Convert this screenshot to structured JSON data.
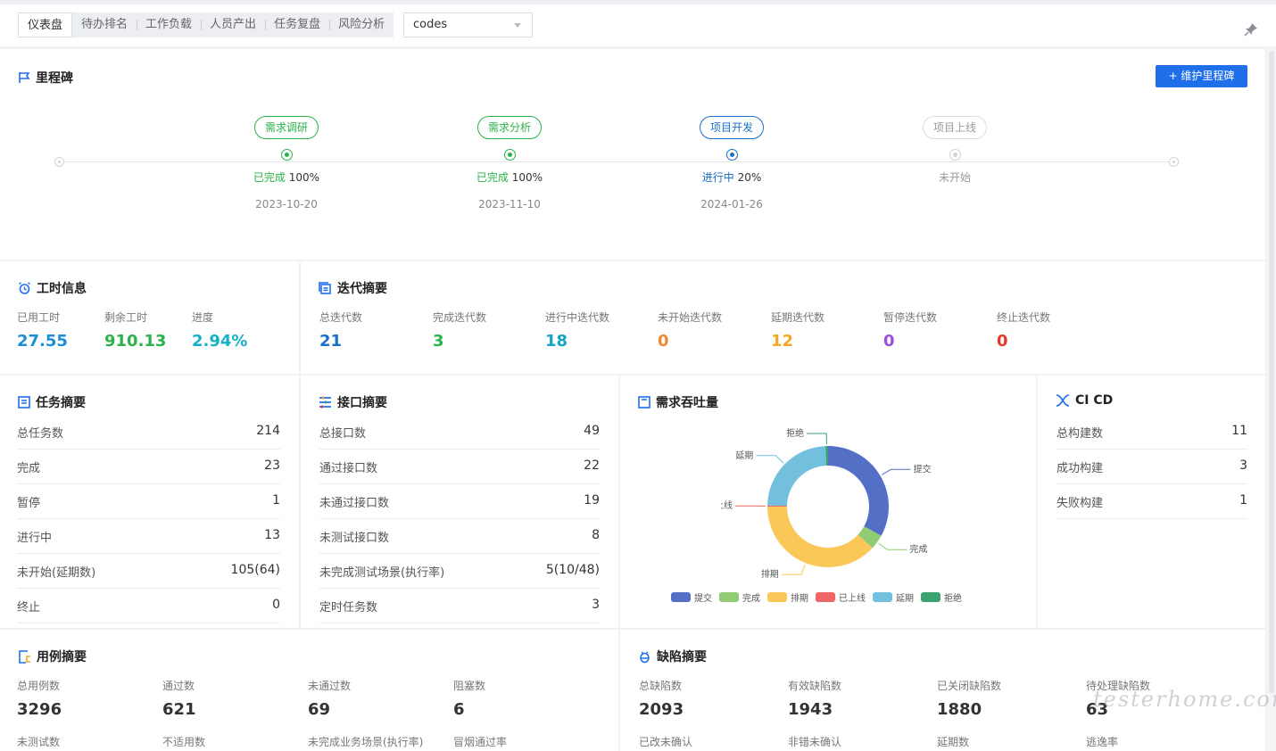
{
  "tabs": [
    "仪表盘",
    "待办排名",
    "工作负载",
    "人员产出",
    "任务复盘",
    "风险分析"
  ],
  "project_select": {
    "value": "codes"
  },
  "milestone": {
    "title": "里程碑",
    "add_button": "+ 维护里程碑",
    "items": [
      {
        "name": "需求调研",
        "status": "已完成",
        "progress": "100%",
        "date": "2023-10-20",
        "state": "done"
      },
      {
        "name": "需求分析",
        "status": "已完成",
        "progress": "100%",
        "date": "2023-11-10",
        "state": "done"
      },
      {
        "name": "项目开发",
        "status": "进行中",
        "progress": "20%",
        "date": "2024-01-26",
        "state": "active"
      },
      {
        "name": "项目上线",
        "status": "未开始",
        "progress": "",
        "date": "",
        "state": "todo"
      }
    ]
  },
  "worktime": {
    "title": "工时信息",
    "stats": [
      {
        "label": "已用工时",
        "value": "27.55",
        "color": "#1a8fd8"
      },
      {
        "label": "剩余工时",
        "value": "910.13",
        "color": "#2bb24c"
      },
      {
        "label": "进度",
        "value": "2.94%",
        "color": "#16b0c8"
      }
    ]
  },
  "iteration": {
    "title": "迭代摘要",
    "stats": [
      {
        "label": "总迭代数",
        "value": "21",
        "color": "#1a6fc8"
      },
      {
        "label": "完成迭代数",
        "value": "3",
        "color": "#2bb24c"
      },
      {
        "label": "进行中迭代数",
        "value": "18",
        "color": "#16a3c8"
      },
      {
        "label": "未开始迭代数",
        "value": "0",
        "color": "#f08a2c"
      },
      {
        "label": "延期迭代数",
        "value": "12",
        "color": "#f5a623"
      },
      {
        "label": "暂停迭代数",
        "value": "0",
        "color": "#9b4ddb"
      },
      {
        "label": "终止迭代数",
        "value": "0",
        "color": "#e8382c"
      }
    ]
  },
  "task": {
    "title": "任务摘要",
    "rows": [
      {
        "k": "总任务数",
        "v": "214"
      },
      {
        "k": "完成",
        "v": "23"
      },
      {
        "k": "暂停",
        "v": "1"
      },
      {
        "k": "进行中",
        "v": "13"
      },
      {
        "k": "未开始(延期数)",
        "v": "105(64)"
      },
      {
        "k": "终止",
        "v": "0"
      }
    ]
  },
  "api": {
    "title": "接口摘要",
    "rows": [
      {
        "k": "总接口数",
        "v": "49"
      },
      {
        "k": "通过接口数",
        "v": "22"
      },
      {
        "k": "未通过接口数",
        "v": "19"
      },
      {
        "k": "未测试接口数",
        "v": "8"
      },
      {
        "k": "未完成测试场景(执行率)",
        "v": "5(10/48)"
      },
      {
        "k": "定时任务数",
        "v": "3"
      }
    ]
  },
  "demand": {
    "title": "需求吞吐量",
    "labels": {
      "submit": "提交",
      "done": "完成",
      "schedule": "排期",
      "online": "已上线",
      "delay": "延期",
      "reject": "拒绝"
    }
  },
  "chart_data": {
    "type": "pie",
    "title": "需求吞吐量",
    "categories": [
      "提交",
      "完成",
      "排期",
      "已上线",
      "延期",
      "拒绝"
    ],
    "values": [
      33,
      4,
      38,
      0.3,
      24,
      0.7
    ],
    "colors": [
      "#5470c6",
      "#91cc75",
      "#fac858",
      "#ee6666",
      "#73c0de",
      "#3ba272"
    ],
    "legend": "bottom"
  },
  "cicd": {
    "title": "CI CD",
    "rows": [
      {
        "k": "总构建数",
        "v": "11"
      },
      {
        "k": "成功构建",
        "v": "3"
      },
      {
        "k": "失败构建",
        "v": "1"
      }
    ]
  },
  "case": {
    "title": "用例摘要",
    "stats": [
      {
        "label": "总用例数",
        "value": "3296"
      },
      {
        "label": "通过数",
        "value": "621"
      },
      {
        "label": "未通过数",
        "value": "69"
      },
      {
        "label": "阻塞数",
        "value": "6"
      }
    ],
    "labels2": [
      "未测试数",
      "不适用数",
      "未完成业务场景(执行率)",
      "冒烟通过率"
    ]
  },
  "defect": {
    "title": "缺陷摘要",
    "stats": [
      {
        "label": "总缺陷数",
        "value": "2093"
      },
      {
        "label": "有效缺陷数",
        "value": "1943"
      },
      {
        "label": "已关闭缺陷数",
        "value": "1880"
      },
      {
        "label": "待处理缺陷数",
        "value": "63"
      }
    ],
    "labels2": [
      "已改未确认",
      "非错未确认",
      "延期数",
      "逃逸率"
    ]
  },
  "watermark": "testerhome.com"
}
